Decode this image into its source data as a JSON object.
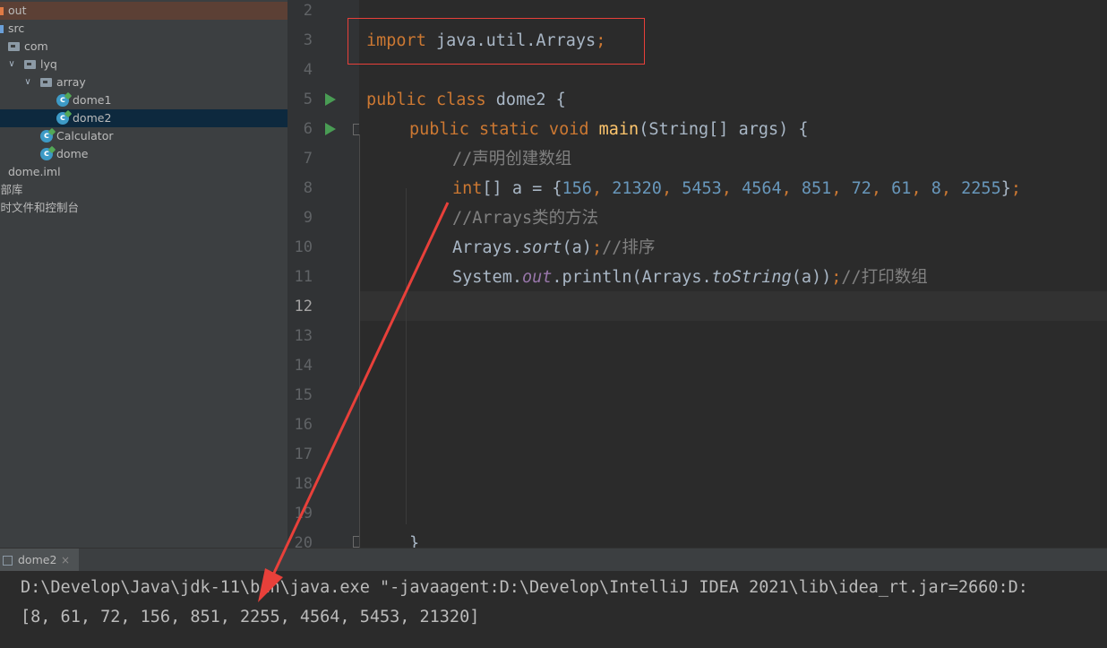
{
  "project_tree": {
    "items": [
      {
        "label": "out"
      },
      {
        "label": "src"
      },
      {
        "label": "com"
      },
      {
        "label": "lyq"
      },
      {
        "label": "array"
      },
      {
        "label": "dome1"
      },
      {
        "label": "dome2"
      },
      {
        "label": "Calculator"
      },
      {
        "label": "dome"
      },
      {
        "label": "dome.iml"
      },
      {
        "label": "卜部库"
      },
      {
        "label": "占时文件和控制台"
      }
    ]
  },
  "editor": {
    "line_numbers": [
      "2",
      "3",
      "4",
      "5",
      "6",
      "7",
      "8",
      "9",
      "10",
      "11",
      "12",
      "13",
      "14",
      "15",
      "16",
      "17",
      "18",
      "19",
      "20"
    ],
    "current_line": "12",
    "code": {
      "l3_import": "import",
      "l3_path": " java.util.Arrays",
      "l3_semi": ";",
      "l5_public": "public",
      "l5_class": " class",
      "l5_rest": " dome2 {",
      "l6_public": "public",
      "l6_static": " static",
      "l6_void": " void",
      "l6_main": " main",
      "l6_rest": "(String[] args) {",
      "l7_comment": "//声明创建数组",
      "l8_int": "int",
      "l8_decl": "[] a = {",
      "l8_values": [
        "156",
        "21320",
        "5453",
        "4564",
        "851",
        "72",
        "61",
        "8",
        "2255"
      ],
      "l8_end": "}",
      "l8_semi": ";",
      "l9_comment": "//Arrays类的方法",
      "l10_obj": "Arrays.",
      "l10_method": "sort",
      "l10_args": "(a)",
      "l10_semi": ";",
      "l10_comment": "//排序",
      "l11_obj": "System.",
      "l11_field": "out",
      "l11_call": ".println(Arrays.",
      "l11_method": "toString",
      "l11_args": "(a))",
      "l11_semi": ";",
      "l11_comment": "//打印数组",
      "l20_brace": "}"
    }
  },
  "run_panel": {
    "tab_label": "dome2",
    "close_glyph": "×",
    "lines": [
      "D:\\Develop\\Java\\jdk-11\\bin\\java.exe \"-javaagent:D:\\Develop\\IntelliJ IDEA 2021\\lib\\idea_rt.jar=2660:D:",
      "[8, 61, 72, 156, 851, 2255, 4564, 5453, 21320]"
    ]
  },
  "colors": {
    "annotation_red": "#e8403a",
    "keyword": "#cc7832",
    "number": "#6897bb",
    "comment": "#808080",
    "method": "#ffc66d"
  }
}
